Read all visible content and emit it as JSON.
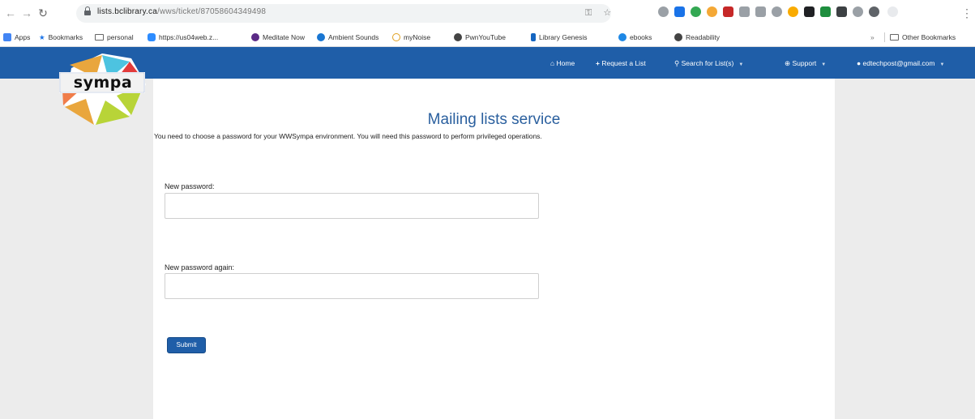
{
  "browser": {
    "url_host": "lists.bclibrary.ca",
    "url_path": "/wws/ticket/87058604349498",
    "bookmarks": [
      {
        "label": "Apps",
        "icon": "apps-grid-icon"
      },
      {
        "label": "Bookmarks",
        "icon": "star-icon"
      },
      {
        "label": "personal",
        "icon": "folder-icon"
      },
      {
        "label": "https://us04web.z...",
        "icon": "zoom-icon"
      },
      {
        "label": "Meditate Now",
        "icon": "meditate-icon"
      },
      {
        "label": "Ambient Sounds",
        "icon": "ambient-icon"
      },
      {
        "label": "myNoise",
        "icon": "mynoise-icon"
      },
      {
        "label": "PwnYouTube",
        "icon": "globe-icon"
      },
      {
        "label": "Library Genesis",
        "icon": "libgen-icon"
      },
      {
        "label": "ebooks",
        "icon": "globe-icon"
      },
      {
        "label": "Readability",
        "icon": "globe-icon"
      },
      {
        "label": "Other Bookmarks",
        "icon": "folder-icon"
      }
    ]
  },
  "navbar": {
    "home": "Home",
    "request": "Request a List",
    "search": "Search for List(s)",
    "support": "Support",
    "account": "edtechpost@gmail.com"
  },
  "logo": {
    "text": "sympa"
  },
  "main": {
    "title": "Mailing lists service",
    "intro": "You need to choose a password for your WWSympa environment. You will need this password to perform privileged operations.",
    "new_password_label": "New password:",
    "new_password_value": "",
    "new_password_again_label": "New password again:",
    "new_password_again_value": "",
    "submit_label": "Submit"
  }
}
